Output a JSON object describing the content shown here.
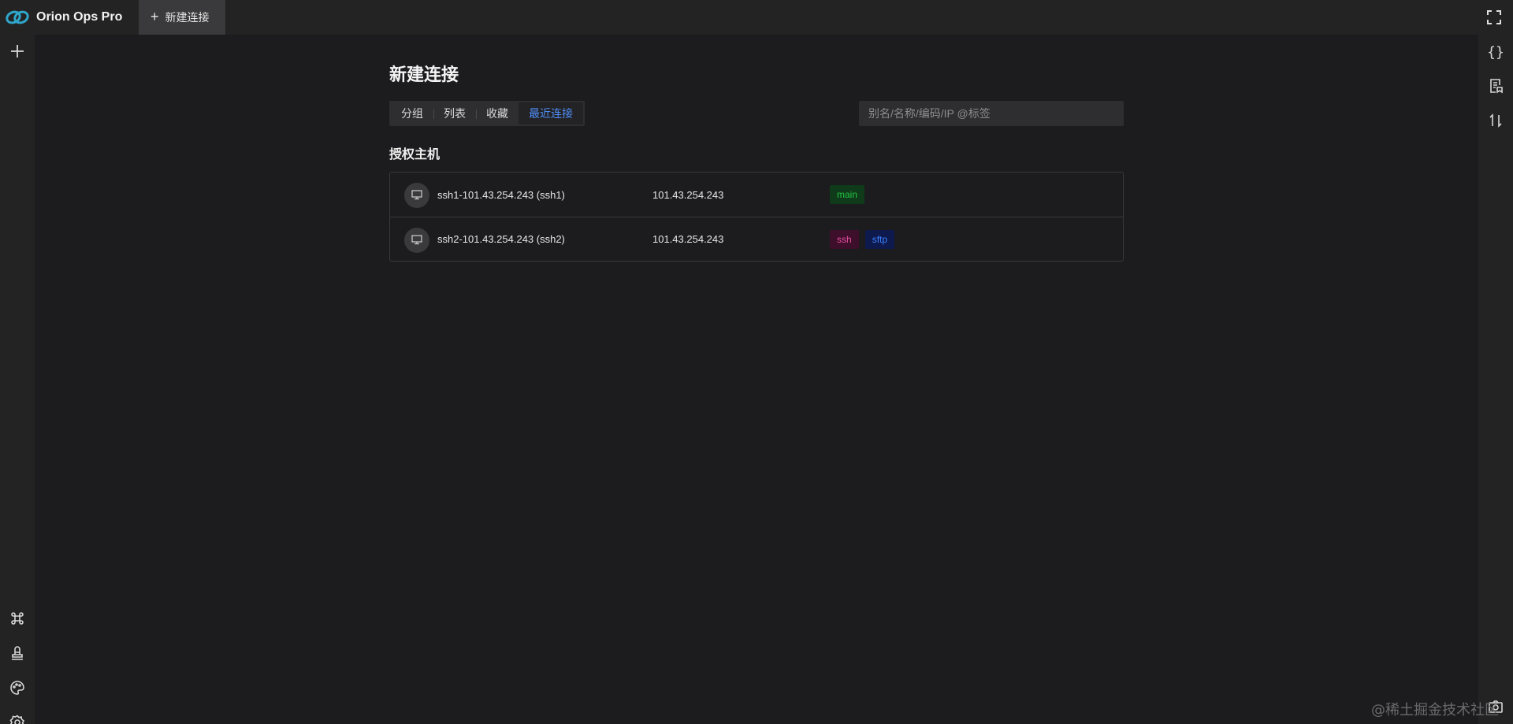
{
  "app": {
    "name": "Orion Ops Pro"
  },
  "tabs": [
    {
      "label": "新建连接",
      "active": true
    }
  ],
  "left_sidebar": {
    "top_items": [
      {
        "icon": "plus-icon"
      }
    ],
    "bottom_items": [
      {
        "icon": "command-icon"
      },
      {
        "icon": "stamp-icon"
      },
      {
        "icon": "palette-icon"
      },
      {
        "icon": "gear-icon"
      }
    ]
  },
  "right_sidebar": {
    "items": [
      {
        "icon": "braces-icon"
      },
      {
        "icon": "document-icon"
      },
      {
        "icon": "transfer-icon"
      }
    ],
    "bottom_items": [
      {
        "icon": "screenshot-icon"
      }
    ]
  },
  "main": {
    "title": "新建连接",
    "view_tabs": [
      {
        "label": "分组",
        "active": false
      },
      {
        "label": "列表",
        "active": false
      },
      {
        "label": "收藏",
        "active": false
      },
      {
        "label": "最近连接",
        "active": true
      }
    ],
    "search": {
      "placeholder": "别名/名称/编码/IP @标签",
      "value": ""
    },
    "section_title": "授权主机",
    "hosts": [
      {
        "name": "ssh1-101.43.254.243 (ssh1)",
        "address": "101.43.254.243",
        "tags": [
          {
            "label": "main",
            "color": "#23c343",
            "bg": "#0f3b1a"
          }
        ]
      },
      {
        "name": "ssh2-101.43.254.243 (ssh2)",
        "address": "101.43.254.243",
        "tags": [
          {
            "label": "ssh",
            "color": "#e84fa0",
            "bg": "#3d0f2a"
          },
          {
            "label": "sftp",
            "color": "#3c7eff",
            "bg": "#0e1a4d"
          }
        ]
      }
    ]
  },
  "watermark": "@稀土掘金技术社区",
  "colors": {
    "accent": "#4e8df7",
    "background": "#1c1c1e",
    "sidebar": "#232324"
  }
}
